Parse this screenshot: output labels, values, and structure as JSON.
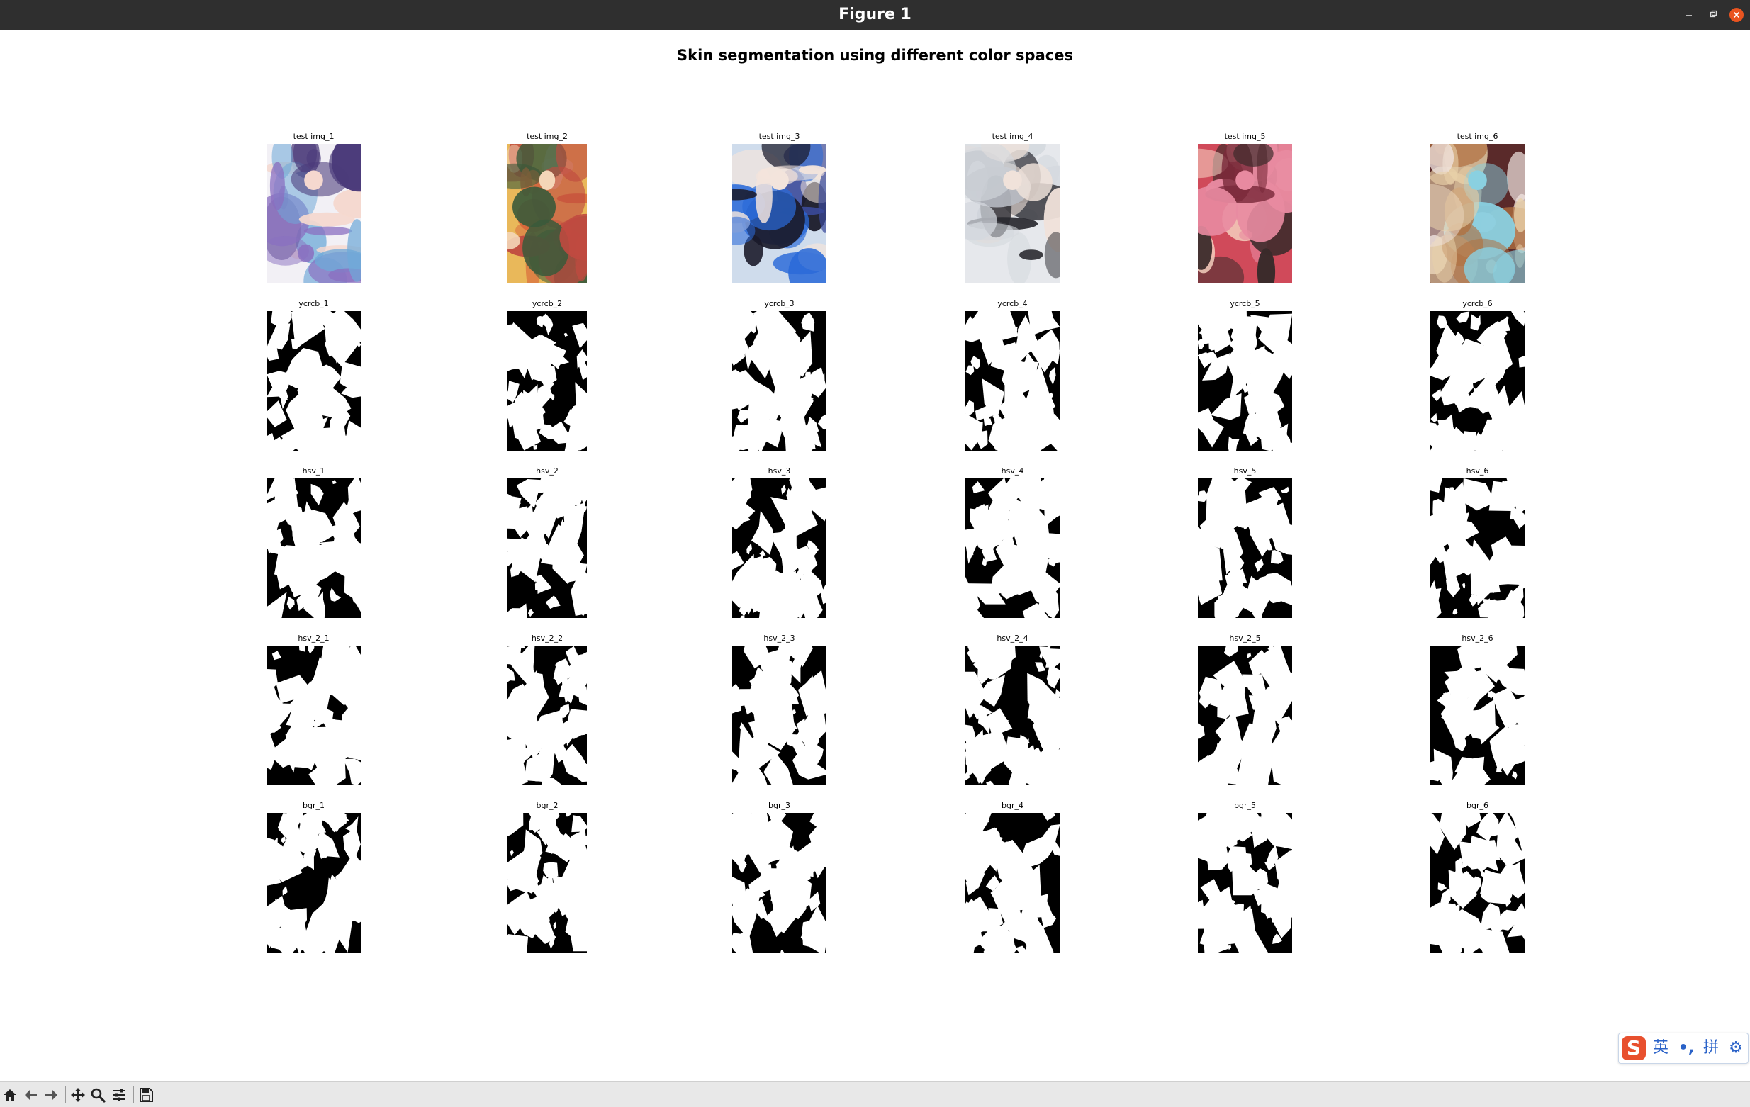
{
  "window": {
    "title": "Figure 1",
    "controls": [
      "minimize-icon",
      "maximize-icon",
      "close-icon"
    ],
    "close_color": "#e95420"
  },
  "figure": {
    "suptitle": "Skin segmentation using different color spaces",
    "rows": [
      {
        "kind": "photo",
        "labels": [
          "test img_1",
          "test img_2",
          "test img_3",
          "test img_4",
          "test img_5",
          "test img_6"
        ]
      },
      {
        "kind": "mask",
        "labels": [
          "ycrcb_1",
          "ycrcb_2",
          "ycrcb_3",
          "ycrcb_4",
          "ycrcb_5",
          "ycrcb_6"
        ]
      },
      {
        "kind": "mask",
        "labels": [
          "hsv_1",
          "hsv_2",
          "hsv_3",
          "hsv_4",
          "hsv_5",
          "hsv_6"
        ]
      },
      {
        "kind": "mask",
        "labels": [
          "hsv_2_1",
          "hsv_2_2",
          "hsv_2_3",
          "hsv_2_4",
          "hsv_2_5",
          "hsv_2_6"
        ]
      },
      {
        "kind": "mask",
        "labels": [
          "bgr_1",
          "bgr_2",
          "bgr_3",
          "bgr_4",
          "bgr_5",
          "bgr_6"
        ]
      }
    ],
    "photo_palettes": [
      [
        "#f2f0f5",
        "#8a6fc0",
        "#4a3a7a",
        "#f5d8cf",
        "#6fa9d8"
      ],
      [
        "#e9b85a",
        "#d8663a",
        "#3a5a3a",
        "#f4d6b8",
        "#c04a40"
      ],
      [
        "#cfdcec",
        "#3a4a9a",
        "#2a6ad8",
        "#f3e4dc",
        "#1a1a2a"
      ],
      [
        "#e6e8ec",
        "#b8bcc4",
        "#2a2a30",
        "#f0e2da",
        "#d4d8de"
      ],
      [
        "#d04a5a",
        "#7a2a3a",
        "#f4d0c0",
        "#e88aa0",
        "#3a2a2a"
      ],
      [
        "#5a2a2a",
        "#e8d0a8",
        "#b07040",
        "#8ad0e0",
        "#f0e4e0"
      ]
    ]
  },
  "ime": {
    "logo": "S",
    "segments": [
      "英",
      "•,",
      "拼",
      "⚙"
    ],
    "accent": "#2a62c8"
  },
  "toolbar": {
    "buttons": [
      "home-icon",
      "back-icon",
      "forward-icon",
      "pan-icon",
      "zoom-icon",
      "configure-subplots-icon",
      "save-icon"
    ]
  }
}
